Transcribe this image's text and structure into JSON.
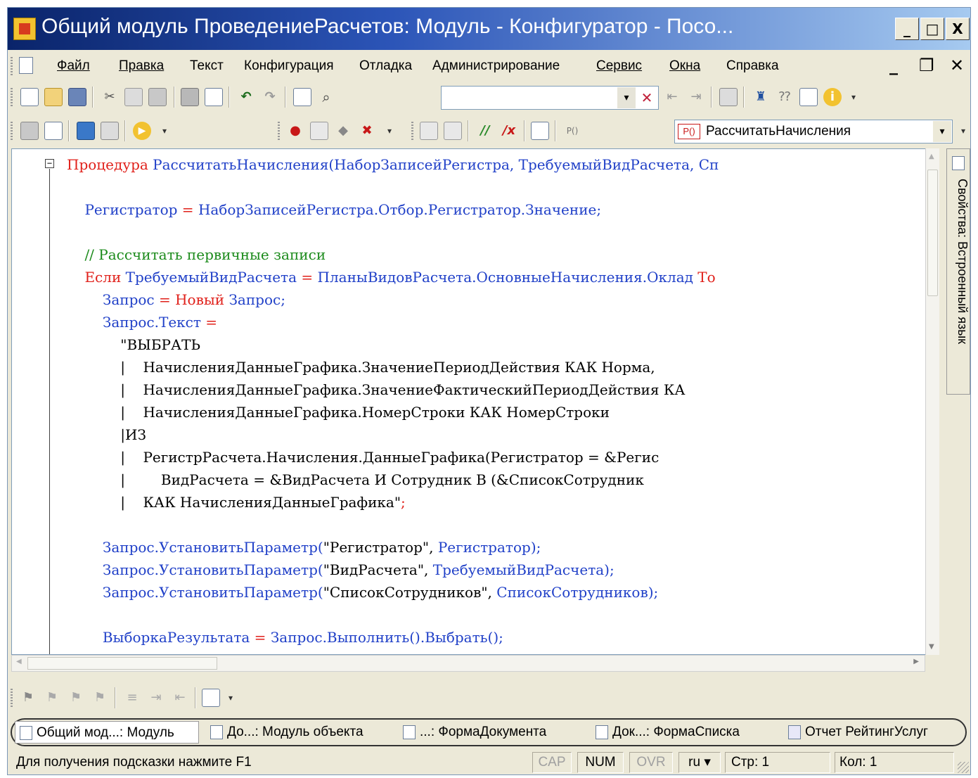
{
  "window": {
    "title": "Общий модуль ПроведениеРасчетов: Модуль - Конфигуратор - Посо...",
    "min_label": "_",
    "max_label": "□",
    "close_label": "X"
  },
  "menu": {
    "items": [
      "Файл",
      "Правка",
      "Текст",
      "Конфигурация",
      "Отладка",
      "Администрирование",
      "Сервис",
      "Окна",
      "Справка"
    ],
    "mdi_min": "_",
    "mdi_restore": "❐",
    "mdi_close": "✕"
  },
  "toolbar": {
    "search_value": "",
    "search_dropdown": "▾",
    "search_clear": "✕",
    "procedure_icon_label": "P()",
    "procedure_selected": "РассчитатьНачисления",
    "dropdown_arrow": "▾"
  },
  "icons": {
    "new": "new-document-icon",
    "open": "open-icon",
    "save": "save-icon",
    "cut": "cut-icon",
    "copy": "copy-icon",
    "paste": "paste-icon",
    "print": "print-icon",
    "preview": "print-preview-icon",
    "undo": "undo-icon",
    "redo": "redo-icon",
    "find": "find-icon",
    "search": "search-icon",
    "run": "run-icon",
    "info": "info-icon"
  },
  "editor": {
    "lines": [
      [
        {
          "t": "Процедура",
          "c": "kw"
        },
        {
          "t": " ",
          "c": "lit"
        },
        {
          "t": "РассчитатьНачисления(НаборЗаписейРегистра, ТребуемыйВидРасчета, Сп",
          "c": "id"
        }
      ],
      [],
      [
        {
          "t": "    ",
          "c": "lit"
        },
        {
          "t": "Регистратор",
          "c": "id"
        },
        {
          "t": " = ",
          "c": "op"
        },
        {
          "t": "НаборЗаписейРегистра.Отбор.Регистратор.Значение;",
          "c": "id"
        }
      ],
      [],
      [
        {
          "t": "    ",
          "c": "lit"
        },
        {
          "t": "// Рассчитать первичные записи",
          "c": "cm"
        }
      ],
      [
        {
          "t": "    ",
          "c": "lit"
        },
        {
          "t": "Если",
          "c": "kw"
        },
        {
          "t": " ",
          "c": "lit"
        },
        {
          "t": "ТребуемыйВидРасчета",
          "c": "id"
        },
        {
          "t": " = ",
          "c": "op"
        },
        {
          "t": "ПланыВидовРасчета.ОсновныеНачисления.Оклад",
          "c": "id"
        },
        {
          "t": " ",
          "c": "lit"
        },
        {
          "t": "То",
          "c": "kw"
        }
      ],
      [
        {
          "t": "        ",
          "c": "lit"
        },
        {
          "t": "Запрос",
          "c": "id"
        },
        {
          "t": " = ",
          "c": "op"
        },
        {
          "t": "Новый",
          "c": "kw"
        },
        {
          "t": " ",
          "c": "lit"
        },
        {
          "t": "Запрос;",
          "c": "id"
        }
      ],
      [
        {
          "t": "        ",
          "c": "lit"
        },
        {
          "t": "Запрос.Текст",
          "c": "id"
        },
        {
          "t": " =",
          "c": "op"
        }
      ],
      [
        {
          "t": "            \"ВЫБРАТЬ",
          "c": "lit"
        }
      ],
      [
        {
          "t": "            |    НачисленияДанныеГрафика.ЗначениеПериодДействия КАК Норма,",
          "c": "lit"
        }
      ],
      [
        {
          "t": "            |    НачисленияДанныеГрафика.ЗначениеФактическийПериодДействия КА",
          "c": "lit"
        }
      ],
      [
        {
          "t": "            |    НачисленияДанныеГрафика.НомерСтроки КАК НомерСтроки",
          "c": "lit"
        }
      ],
      [
        {
          "t": "            |ИЗ",
          "c": "lit"
        }
      ],
      [
        {
          "t": "            |    РегистрРасчета.Начисления.ДанныеГрафика(Регистратор = &Регис",
          "c": "lit"
        }
      ],
      [
        {
          "t": "            |        ВидРасчета = &ВидРасчета И Сотрудник В (&СписокСотрудник",
          "c": "lit"
        }
      ],
      [
        {
          "t": "            |    КАК НачисленияДанныеГрафика\"",
          "c": "lit"
        },
        {
          "t": ";",
          "c": "op"
        }
      ],
      [],
      [
        {
          "t": "        ",
          "c": "lit"
        },
        {
          "t": "Запрос.УстановитьПараметр(",
          "c": "id"
        },
        {
          "t": "\"Регистратор\", ",
          "c": "lit"
        },
        {
          "t": "Регистратор);",
          "c": "id"
        }
      ],
      [
        {
          "t": "        ",
          "c": "lit"
        },
        {
          "t": "Запрос.УстановитьПараметр(",
          "c": "id"
        },
        {
          "t": "\"ВидРасчета\", ",
          "c": "lit"
        },
        {
          "t": "ТребуемыйВидРасчета);",
          "c": "id"
        }
      ],
      [
        {
          "t": "        ",
          "c": "lit"
        },
        {
          "t": "Запрос.УстановитьПараметр(",
          "c": "id"
        },
        {
          "t": "\"СписокСотрудников\", ",
          "c": "lit"
        },
        {
          "t": "СписокСотрудников);",
          "c": "id"
        }
      ],
      [],
      [
        {
          "t": "        ",
          "c": "lit"
        },
        {
          "t": "ВыборкаРезультата",
          "c": "id"
        },
        {
          "t": " = ",
          "c": "op"
        },
        {
          "t": "Запрос.Выполнить().Выбрать();",
          "c": "id"
        }
      ]
    ],
    "fold_marker": "−"
  },
  "sidebar": {
    "label": "Свойства: Встроенный язык"
  },
  "tabs": [
    {
      "label": "Общий мод...: Модуль",
      "active": true
    },
    {
      "label": "До...: Модуль объекта",
      "active": false
    },
    {
      "label": "...: ФормаДокумента",
      "active": false
    },
    {
      "label": "Док...: ФормаСписка",
      "active": false
    },
    {
      "label": "Отчет РейтингУслуг",
      "active": false
    }
  ],
  "status": {
    "hint": "Для получения подсказки нажмите F1",
    "cap": "CAP",
    "num": "NUM",
    "ovr": "OVR",
    "lang": "ru ▾",
    "line": "Стр: 1",
    "col": "Кол: 1"
  },
  "colors": {
    "keyword": "#e0201a",
    "identifier": "#2040c8",
    "comment": "#1a8a1a",
    "title_gradient_start": "#0a246a",
    "title_gradient_end": "#a6caf0"
  }
}
